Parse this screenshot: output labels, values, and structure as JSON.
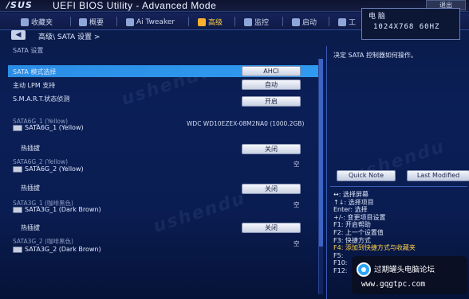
{
  "titlebar": {
    "logo": "/SUS",
    "title": "UEFI BIOS Utility - Advanced Mode",
    "exit_label": "退出"
  },
  "menu": {
    "items": [
      {
        "label": "收藏夹",
        "icon": "star-icon"
      },
      {
        "label": "概要",
        "icon": "list-icon"
      },
      {
        "label": "Ai Tweaker",
        "icon": "tweaker-icon"
      },
      {
        "label": "高级",
        "icon": "advanced-icon"
      },
      {
        "label": "监控",
        "icon": "monitor-icon"
      },
      {
        "label": "启动",
        "icon": "power-icon"
      },
      {
        "label": "工",
        "icon": "tool-icon"
      }
    ]
  },
  "infobox": {
    "label": "电 脑",
    "resolution": "1024X768 60HZ"
  },
  "breadcrumb": "高级\\ SATA 设置 >",
  "section_title": "SATA 设置",
  "settings": {
    "sata_mode": {
      "label": "SATA 模式选择",
      "value": "AHCI"
    },
    "lpm": {
      "label": "主动 LPM 支持",
      "value": "自动"
    },
    "smart": {
      "label": "S.M.A.R.T.状态侦测",
      "value": "开启"
    }
  },
  "ports": [
    {
      "header": "SATA6G_1 (Yellow)",
      "name": "SATA6G_1 (Yellow)",
      "info": "WDC WD10EZEX-08M2NA0 (1000.2GB)",
      "hotplug": "热插拔",
      "hotplug_value": "关闭"
    },
    {
      "header": "SATA6G_2 (Yellow)",
      "name": "SATA6G_2 (Yellow)",
      "info": "空",
      "hotplug": "热插拔",
      "hotplug_value": "关闭"
    },
    {
      "header": "SATA3G_1 (咖啡黑色)",
      "name": "SATA3G_1 (Dark Brown)",
      "info": "空",
      "hotplug": "热插拔",
      "hotplug_value": "关闭"
    },
    {
      "header": "SATA3G_2 (咖啡黑色)",
      "name": "SATA3G_2 (Dark Brown)",
      "info": "空"
    }
  ],
  "help": {
    "text": "决定 SATA 控制器如何操作。",
    "quick_note": "Quick Note",
    "last_modified": "Last Modified"
  },
  "keys": [
    "↔: 选择屏幕",
    "↑↓: 选择项目",
    "Enter: 选择",
    "+/-: 变更项目设置",
    "F1: 开启帮助",
    "F2: 上一个设置值",
    "F3: 快捷方式",
    "F4: 添加到快捷方式与收藏夹",
    "F5:",
    "F10:",
    "F12:"
  ],
  "watermark": "ushendu",
  "badge": {
    "name": "过期罐头电脑论坛",
    "url": "www.gqgtpc.com"
  }
}
